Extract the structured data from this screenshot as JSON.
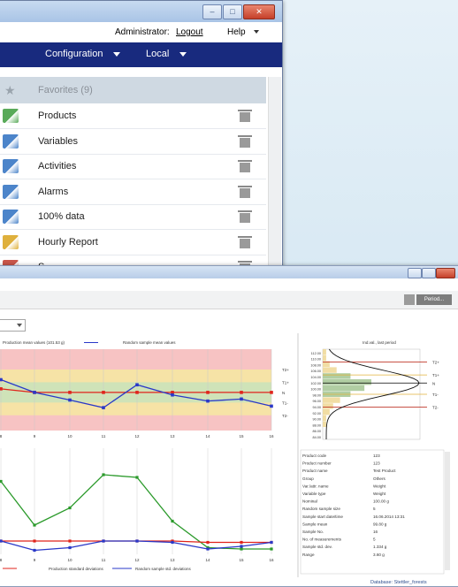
{
  "back_window": {
    "user_label": "Administrator: ",
    "logout_label": "Logout",
    "help_label": "Help",
    "nav": {
      "configuration": "Configuration",
      "local": "Local"
    },
    "favorites_label": "Favorites (9)",
    "items": [
      {
        "label": "Products",
        "icon": "products-icon"
      },
      {
        "label": "Variables",
        "icon": "variables-icon"
      },
      {
        "label": "Activities",
        "icon": "activities-icon"
      },
      {
        "label": "Alarms",
        "icon": "alarms-icon"
      },
      {
        "label": "100% data",
        "icon": "data-icon"
      },
      {
        "label": "Hourly Report",
        "icon": "hourly-report-icon"
      },
      {
        "label": "S...",
        "icon": "report-icon"
      }
    ]
  },
  "front_window": {
    "period_label": "Period...",
    "database_label": "Database: Stettler_forests",
    "chart_top_title": "Ind.val., last period"
  },
  "chart_data": [
    {
      "type": "line",
      "title": "",
      "x": [
        8,
        9,
        10,
        11,
        12,
        13,
        14,
        15,
        16
      ],
      "series": [
        {
          "name": "Production mean values (101.53 g)",
          "values": [
            102.2,
            101.5,
            101.5,
            101.5,
            101.5,
            101.5,
            101.5,
            101.5,
            101.5
          ]
        },
        {
          "name": "Random sample mean values",
          "values": [
            104.0,
            101.5,
            100.0,
            98.5,
            103.0,
            101.0,
            99.8,
            100.2,
            98.8
          ]
        }
      ],
      "limit_labels": [
        "T2+",
        "T1+",
        "N",
        "T1-",
        "T2-"
      ],
      "ylim": [
        94,
        110
      ]
    },
    {
      "type": "line",
      "title": "",
      "x": [
        8,
        9,
        10,
        11,
        12,
        13,
        14,
        15,
        16
      ],
      "series": [
        {
          "name": "",
          "values": [
            5.5,
            2.2,
            3.5,
            6.0,
            5.8,
            2.5,
            0.5,
            0.4,
            0.4
          ]
        },
        {
          "name": "Production standard deviations",
          "values": [
            1.0,
            1.0,
            1.0,
            1.0,
            1.0,
            1.0,
            0.9,
            0.9,
            0.9
          ]
        },
        {
          "name": "Random sample std. deviations",
          "values": [
            1.0,
            0.3,
            0.5,
            1.0,
            1.0,
            0.9,
            0.4,
            0.6,
            0.9
          ]
        }
      ],
      "ylim": [
        0,
        8
      ]
    },
    {
      "type": "bar",
      "title": "Ind.val., last period",
      "categories": [
        "84.00",
        "86.00",
        "88.00",
        "90.00",
        "92.00",
        "94.00",
        "96.00",
        "98.00",
        "100.00",
        "102.00",
        "104.00",
        "106.00",
        "108.00",
        "110.00",
        "112.00"
      ],
      "values": [
        0,
        0,
        1,
        1,
        2,
        3,
        5,
        8,
        12,
        14,
        8,
        4,
        2,
        1,
        1
      ],
      "limit_labels": [
        "T2+",
        "T1+",
        "N",
        "T1-",
        "T2-"
      ]
    }
  ],
  "info_table": {
    "rows": [
      {
        "k": "Product code",
        "v": "123"
      },
      {
        "k": "Product number",
        "v": "123"
      },
      {
        "k": "Product name",
        "v": "Test Product"
      },
      {
        "k": "Group",
        "v": "Others"
      },
      {
        "k": "Var./attr. name",
        "v": "Weight"
      },
      {
        "k": "Variable type",
        "v": "Weight"
      },
      {
        "k": "Nominal",
        "v": "100.00 g"
      },
      {
        "k": "Random sample size",
        "v": "5"
      },
      {
        "k": "Sample start date/time",
        "v": "16.06.2014 13:31"
      },
      {
        "k": "Sample mean",
        "v": "99.80 g"
      },
      {
        "k": "Sample No.",
        "v": "16"
      },
      {
        "k": "No. of measurements",
        "v": "5"
      },
      {
        "k": "Sample std. dev.",
        "v": "1.334 g"
      },
      {
        "k": "Range",
        "v": "3.60 g"
      }
    ]
  },
  "colors": {
    "nav_bg": "#182a7e",
    "mean_red": "#e0231b",
    "mean_blue": "#2a38c8",
    "green_line": "#2b9a2b"
  }
}
